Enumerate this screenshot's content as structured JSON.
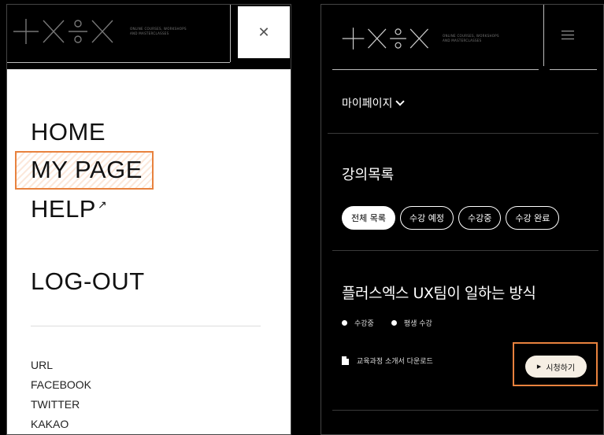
{
  "left": {
    "logo_tagline": [
      "ONLINE COURSES, WORKSHOPS",
      "AND MASTERCLASSES"
    ],
    "close_icon": "close-icon",
    "menu": {
      "home": "HOME",
      "mypage": "MY PAGE",
      "help": "HELP",
      "help_icon": "↗",
      "logout": "LOG-OUT"
    },
    "links": [
      "URL",
      "FACEBOOK",
      "TWITTER",
      "KAKAO"
    ]
  },
  "right": {
    "logo_tagline": [
      "ONLINE COURSES, WORKSHOPS",
      "AND MASTERCLASSES"
    ],
    "menu_icon": "hamburger-icon",
    "mypage_label": "마이페이지",
    "section_title": "강의목록",
    "filters": [
      "전체 목록",
      "수강 예정",
      "수강중",
      "수강 완료"
    ],
    "course": {
      "title": "플러스엑스 UX팀이 일하는 방식",
      "status": "수강중",
      "access": "평생 수강",
      "download": "교육과정 소개서 다운로드",
      "watch": "시청하기"
    }
  },
  "colors": {
    "highlight": "#e8823e",
    "button_bg": "#f6efe4"
  }
}
